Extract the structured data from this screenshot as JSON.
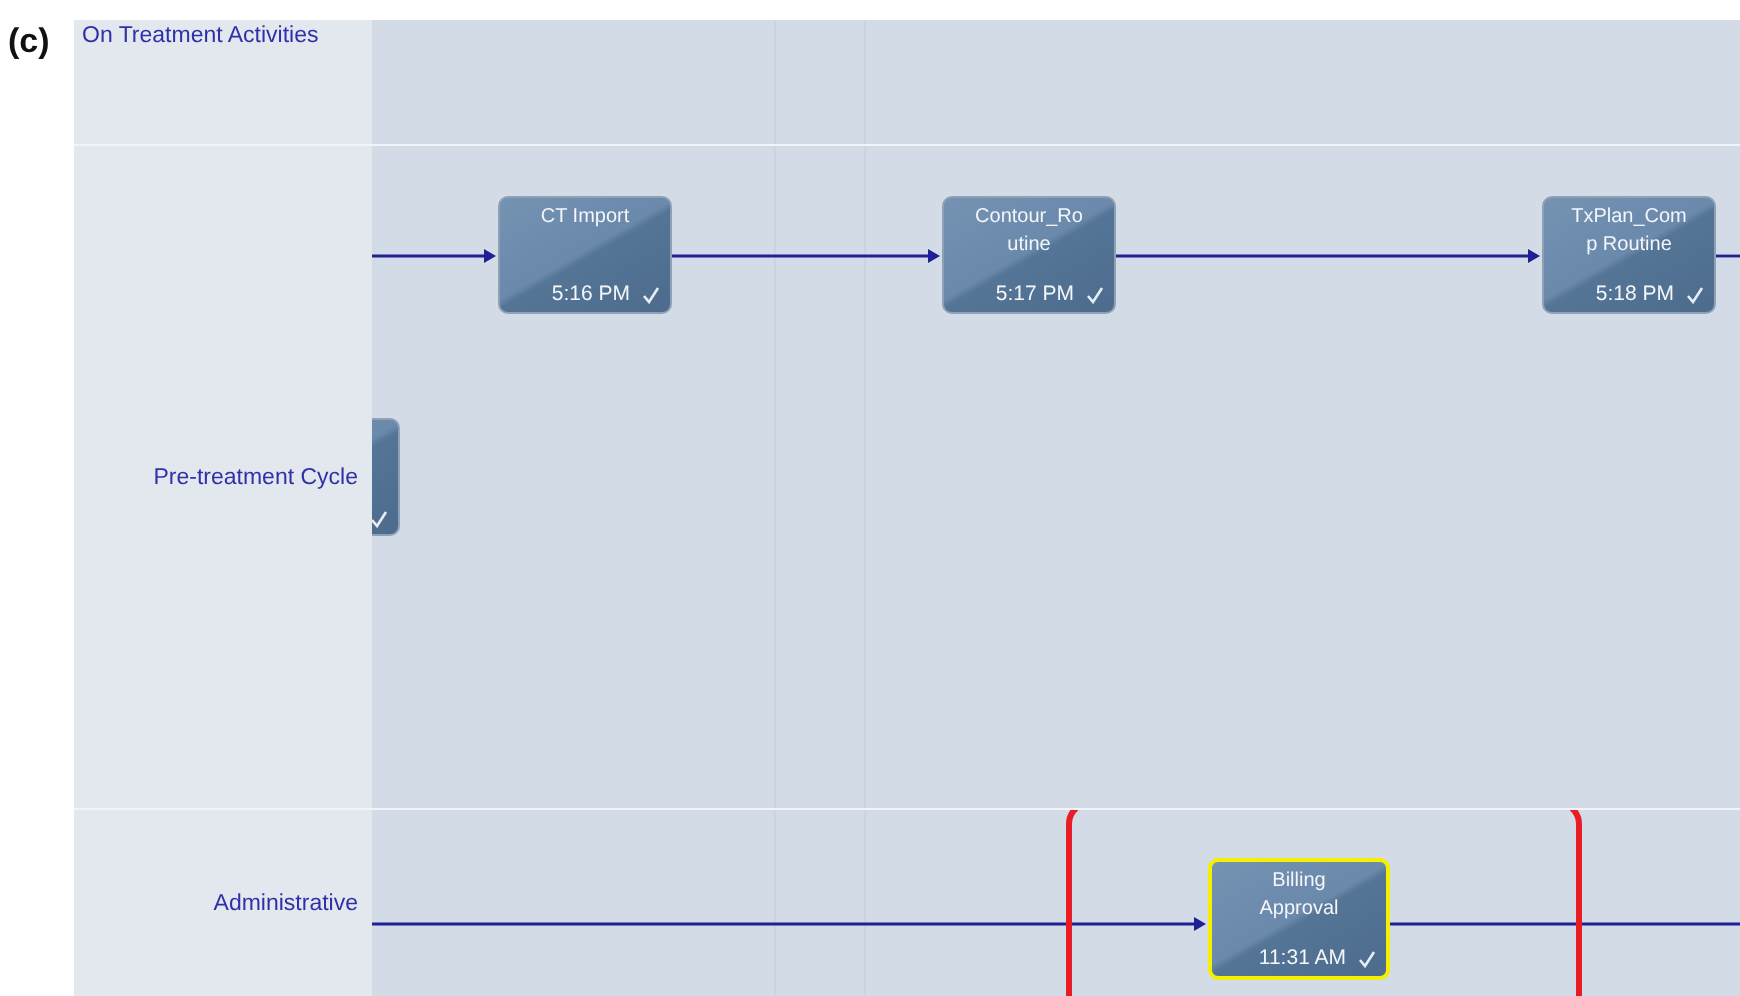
{
  "figure_label": "(c)",
  "lanes": [
    {
      "kind": "section",
      "label": "On Treatment Activities"
    },
    {
      "kind": "lane",
      "label": "Pre-treatment Cycle",
      "nodes": [
        {
          "kind": "partial",
          "done": true,
          "highlighted": false
        },
        {
          "kind": "task",
          "name": "CT Import",
          "time": "5:16 PM",
          "done": true,
          "highlighted": false
        },
        {
          "kind": "task",
          "name": "Contour_Ro utine",
          "time": "5:17 PM",
          "done": true,
          "highlighted": false
        },
        {
          "kind": "task",
          "name": "TxPlan_Com p Routine",
          "time": "5:18 PM",
          "done": true,
          "highlighted": false
        }
      ]
    },
    {
      "kind": "lane",
      "label": "Administrative",
      "nodes": [
        {
          "kind": "task",
          "name": "Billing Approval",
          "time": "11:31 AM",
          "done": true,
          "highlighted": true,
          "circled": true
        }
      ]
    }
  ]
}
